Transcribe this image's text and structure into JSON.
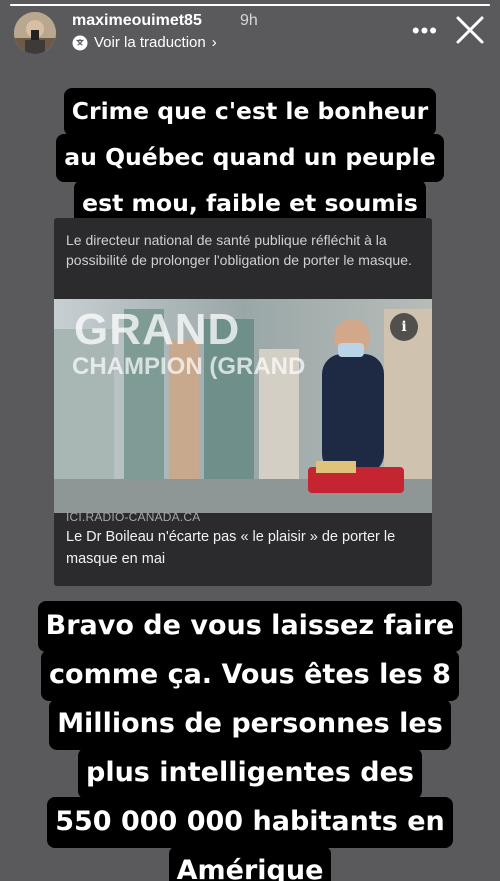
{
  "story": {
    "progress": 1.0,
    "username": "maximeouimet85",
    "time": "9h",
    "translate_label": "Voir la traduction",
    "icons": {
      "translate": "translate-icon",
      "chevron": "chevron-right-icon",
      "more": "more-options-icon",
      "close": "close-icon"
    }
  },
  "captions": {
    "top": [
      "Crime que c'est le bonheur",
      "au Québec quand un peuple",
      "est mou, faible et soumis"
    ],
    "bottom": [
      "Bravo de vous laissez faire",
      "comme ça. Vous êtes les 8",
      "Millions de personnes les",
      "plus intelligentes des",
      "550 000 000 habitants en",
      "Amérique"
    ]
  },
  "card": {
    "header_text": "Le directeur national de santé publique réfléchit à la possibilité de prolonger l'obligation de porter le masque.",
    "image_overlay_big": "GRAND",
    "image_overlay_small": "CHAMPION (GRAND",
    "info_glyph": "i",
    "source": "ICI.RADIO-CANADA.CA",
    "title": "Le Dr Boileau n'écarte pas « le plaisir » de porter le masque en mai"
  },
  "colors": {
    "background": "#5a5a5c",
    "caption_bg": "#000000",
    "card_bg": "#2b2b2d"
  }
}
